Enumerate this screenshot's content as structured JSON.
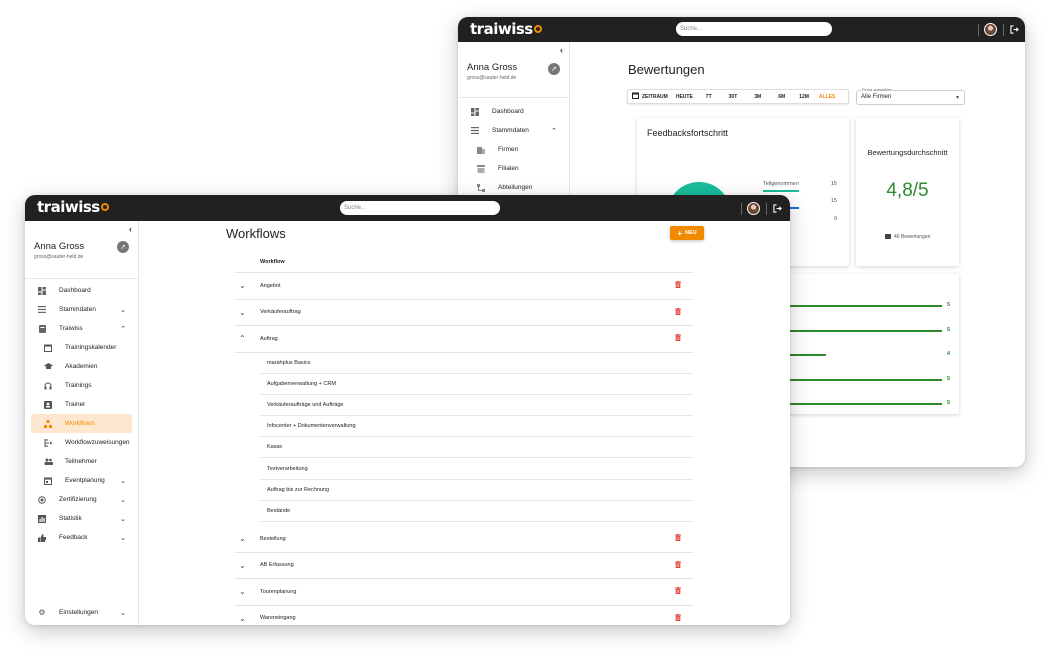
{
  "w1": {
    "logo": "traiwiss",
    "search_placeholder": "Suche...",
    "user": {
      "name": "Anna Gross",
      "email": "gross@sauter-held.de"
    },
    "nav": [
      {
        "label": "Dashboard",
        "icon": "dashboard-icon"
      },
      {
        "label": "Stammdaten",
        "icon": "list-icon",
        "expanded": true
      },
      {
        "label": "Firmen",
        "icon": "building-icon",
        "sub": true
      },
      {
        "label": "Filialen",
        "icon": "store-icon",
        "sub": true
      },
      {
        "label": "Abteilungen",
        "icon": "hierarchy-icon",
        "sub": true
      }
    ],
    "title": "Bewertungen",
    "range": {
      "label": "ZEITRAUM",
      "options": [
        "HEUTE",
        "7T",
        "30T",
        "3M",
        "6M",
        "12M",
        "ALLES"
      ],
      "selected": "ALLES"
    },
    "company_select": {
      "label": "Firma auswählen",
      "value": "Alle Firmen"
    },
    "feedback_card": {
      "title": "Feedbacksfortschritt",
      "legend": [
        {
          "label": "Teilgenommen",
          "value": "15",
          "color": "#1abc9c"
        },
        {
          "label": "",
          "value": "15",
          "color": "#1e6fd9"
        },
        {
          "label": "",
          "value": "0",
          "color": "#999999"
        }
      ]
    },
    "avg_card": {
      "title": "Bewertungsdurchschnitt",
      "value": "4,8/5",
      "count_label": "46 Bewertungen"
    },
    "ratings": [
      {
        "label": "5",
        "level": 1.0
      },
      {
        "label": "5",
        "level": 1.0
      },
      {
        "label": "4",
        "level": 0.8
      },
      {
        "label": "5",
        "level": 1.0
      },
      {
        "label": "5",
        "level": 1.0
      }
    ]
  },
  "w2": {
    "logo": "traiwiss",
    "search_placeholder": "Suche...",
    "user": {
      "name": "Anna Gross",
      "email": "gross@sauter-held.de"
    },
    "nav": [
      {
        "label": "Dashboard",
        "icon": "dashboard-icon"
      },
      {
        "label": "Stammdaten",
        "icon": "list-icon",
        "chev": "down"
      },
      {
        "label": "Traiwiss",
        "icon": "book-icon",
        "chev": "up"
      },
      {
        "label": "Trainingskalender",
        "icon": "calendar-icon",
        "sub": true
      },
      {
        "label": "Akademien",
        "icon": "school-icon",
        "sub": true
      },
      {
        "label": "Trainings",
        "icon": "headset-icon",
        "sub": true
      },
      {
        "label": "Trainer",
        "icon": "badge-icon",
        "sub": true
      },
      {
        "label": "Workflows",
        "icon": "workflow-icon",
        "sub": true,
        "active": true
      },
      {
        "label": "Workflowzuweisungen",
        "icon": "assign-icon",
        "sub": true
      },
      {
        "label": "Teilnehmer",
        "icon": "people-icon",
        "sub": true
      },
      {
        "label": "Eventplanung",
        "icon": "event-icon",
        "sub": true,
        "chev": "down"
      },
      {
        "label": "Zertifizierung",
        "icon": "certificate-icon",
        "chev": "down"
      },
      {
        "label": "Statistik",
        "icon": "chart-icon",
        "chev": "down"
      },
      {
        "label": "Feedback",
        "icon": "thumb-icon",
        "chev": "down"
      }
    ],
    "settings": {
      "label": "Einstellungen",
      "icon": "gear-icon"
    },
    "title": "Workflows",
    "new_button": "NEU",
    "table_header": "Workflow",
    "workflows": [
      {
        "name": "Angebot",
        "expanded": false
      },
      {
        "name": "Verkäuferauftrag",
        "expanded": false
      },
      {
        "name": "Auftrag",
        "expanded": true
      },
      {
        "name": "Bestellung",
        "expanded": false
      },
      {
        "name": "AB Erfassung",
        "expanded": false
      },
      {
        "name": "Tourenplanung",
        "expanded": false
      },
      {
        "name": "Wareneingang",
        "expanded": false
      }
    ],
    "sub_items": [
      "marahplus Basics",
      "Aufgabenverwaltung + CRM",
      "Verkäuferaufträge und Aufträge",
      "Infocenter + Dokumentenverwaltung",
      "Kasse",
      "Textverarbeitung",
      "Auftrag bis zur Rechnung",
      "Bestände"
    ]
  }
}
